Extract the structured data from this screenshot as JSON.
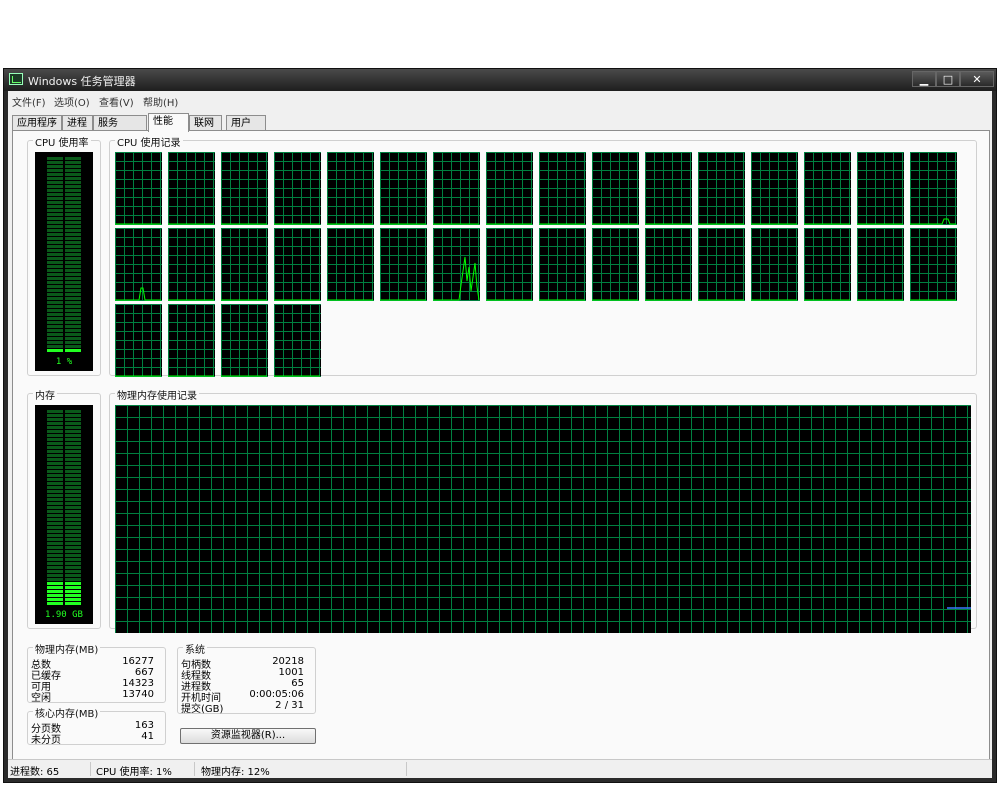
{
  "window": {
    "title": "Windows 任务管理器",
    "minimize": "▁",
    "maximize": "□",
    "close": "✕"
  },
  "menu": [
    "文件(F)",
    "选项(O)",
    "查看(V)",
    "帮助(H)"
  ],
  "tabs": [
    {
      "label": "应用程序",
      "active": false
    },
    {
      "label": "进程",
      "active": false
    },
    {
      "label": "服务",
      "active": false
    },
    {
      "label": "性能",
      "active": true
    },
    {
      "label": "联网",
      "active": false
    },
    {
      "label": "用户",
      "active": false
    }
  ],
  "cpu_usage": {
    "label": "CPU 使用率",
    "value_text": "1 %",
    "percent": 1
  },
  "cpu_history": {
    "label": "CPU 使用记录",
    "cores": 36,
    "columns": 16
  },
  "memory": {
    "label": "内存",
    "value_text": "1.90 GB",
    "fraction": 0.12
  },
  "memory_history": {
    "label": "物理内存使用记录"
  },
  "physical_memory": {
    "label": "物理内存(MB)",
    "rows": [
      {
        "label": "总数",
        "value": "16277"
      },
      {
        "label": "已缓存",
        "value": "667"
      },
      {
        "label": "可用",
        "value": "14323"
      },
      {
        "label": "空闲",
        "value": "13740"
      }
    ]
  },
  "kernel_memory": {
    "label": "核心内存(MB)",
    "rows": [
      {
        "label": "分页数",
        "value": "163"
      },
      {
        "label": "未分页",
        "value": "41"
      }
    ]
  },
  "system": {
    "label": "系统",
    "rows": [
      {
        "label": "句柄数",
        "value": "20218"
      },
      {
        "label": "线程数",
        "value": "1001"
      },
      {
        "label": "进程数",
        "value": "65"
      },
      {
        "label": "开机时间",
        "value": "0:00:05:06"
      },
      {
        "label": "提交(GB)",
        "value": "2 / 31"
      }
    ]
  },
  "resource_monitor_button": "资源监视器(R)...",
  "status": {
    "processes": "进程数: 65",
    "cpu": "CPU 使用率: 1%",
    "memory": "物理内存: 12%"
  },
  "colors": {
    "graph_bg": "#000000",
    "grid": "#008040",
    "line": "#00ff00",
    "mem_line": "#3a7bff"
  }
}
